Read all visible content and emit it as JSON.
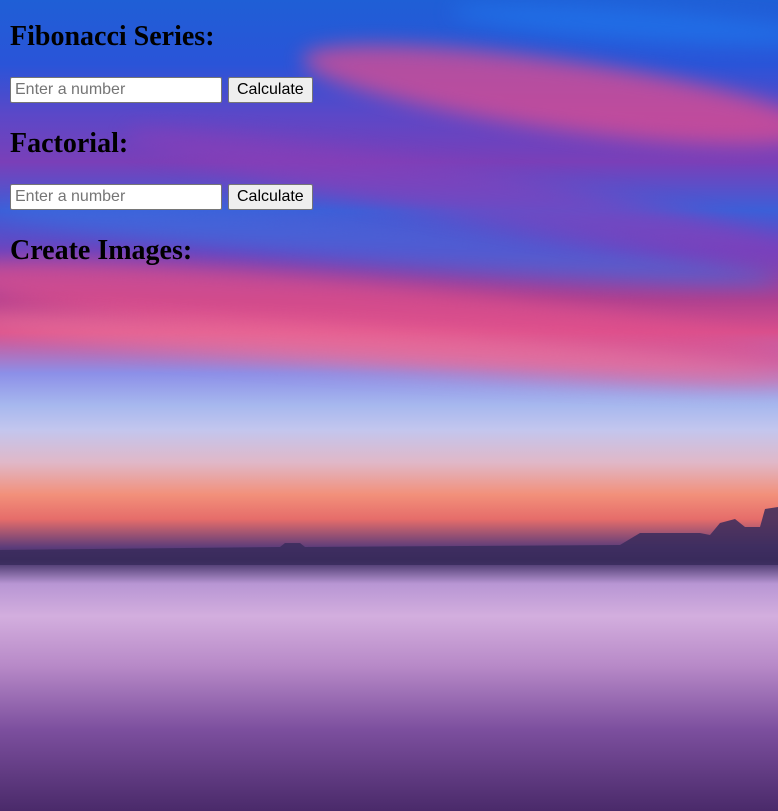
{
  "fibonacci": {
    "heading": "Fibonacci Series:",
    "input_placeholder": "Enter a number",
    "button_label": "Calculate"
  },
  "factorial": {
    "heading": "Factorial:",
    "input_placeholder": "Enter a number",
    "button_label": "Calculate"
  },
  "images": {
    "heading": "Create Images:"
  },
  "background": {
    "description_colors": [
      "#1f5fd6",
      "#d94f8c",
      "#a7b8ee",
      "#f2907a",
      "#b896d4"
    ]
  }
}
